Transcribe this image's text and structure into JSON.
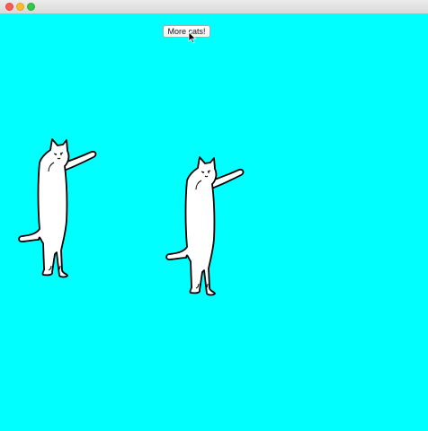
{
  "window": {
    "background_color": "#00ffff",
    "controls": [
      "close-icon",
      "minimize-icon",
      "zoom-icon"
    ]
  },
  "toolbar": {
    "more_cats_label": "More cats!"
  },
  "sprites": [
    {
      "name": "long-cat"
    },
    {
      "name": "long-cat"
    }
  ]
}
